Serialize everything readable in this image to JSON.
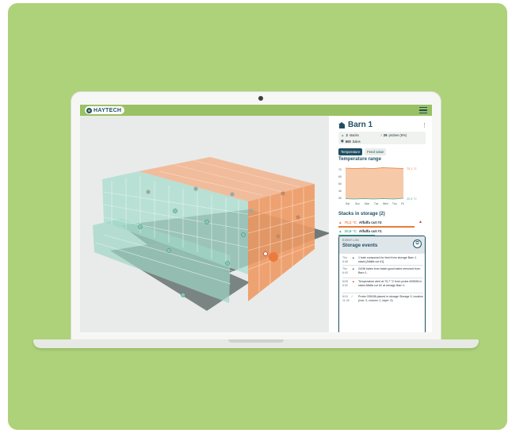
{
  "app": {
    "logo_text": "HAYTECH",
    "colors": {
      "brand": "#1f4f63",
      "appbar": "#9ac163",
      "background_card": "#add27a",
      "orange": "#ea7b3c",
      "teal": "#7fcab4"
    }
  },
  "view3d": {
    "icons": [
      "marker-icon"
    ]
  },
  "panel": {
    "title": "Barn 1",
    "menu_icon": "kebab-icon",
    "stats": {
      "stacks": "2",
      "stacks_label": "stacks",
      "bales": "500",
      "bales_label": "bales",
      "probes": "29",
      "probes_label": "probes (6%)"
    },
    "tabs": [
      {
        "label": "Temperature",
        "active": true
      },
      {
        "label": "Feed value",
        "active": false
      }
    ],
    "temperature_range": {
      "heading": "Temperature range",
      "y_ticks": [
        "70",
        "60",
        "50",
        "40",
        "30"
      ],
      "x_ticks": [
        "Sat",
        "Sun",
        "Mon",
        "Tue",
        "Wed",
        "Thu",
        "Fri"
      ],
      "high_label": "70,1 °C",
      "low_label": "20,9 °C"
    },
    "stacks_heading": "Stacks in storage (2)",
    "stacks": [
      {
        "temp": "70,1 °C",
        "name": "Alfalfa cut #2",
        "status": "warning",
        "color": "#ea7b3c"
      },
      {
        "temp": "20,9 °C",
        "name": "Alfalfa cut #1",
        "status": "ok",
        "color": "#4fae8d"
      }
    ],
    "events": {
      "subtitle": "EVENT LOG",
      "title": "Storage events",
      "button_icon": "expand-icon",
      "items": [
        {
          "date": "Thu 6:48",
          "icon": "stack-icon",
          "text": "1 bale consumed for feed from storage Barn 1 stack [Alfalfa cut #1]."
        },
        {
          "date": "Thu 6:00",
          "icon": "stack-icon",
          "text": "24/36 bales from batch good bales removed from Barn 1."
        },
        {
          "date": "6/28 6:00",
          "icon": "warning-icon",
          "text": "Temperature alert at 70,7 °C from probe #93536 in stack Alfalfa cut #2 at storage Barn 1."
        },
        {
          "date": "6/19 11:40",
          "icon": "probe-icon",
          "text": "Probe 035438 placed in storage Storage 3, location (row: 3, column: 1, layer: 0)"
        }
      ]
    }
  }
}
